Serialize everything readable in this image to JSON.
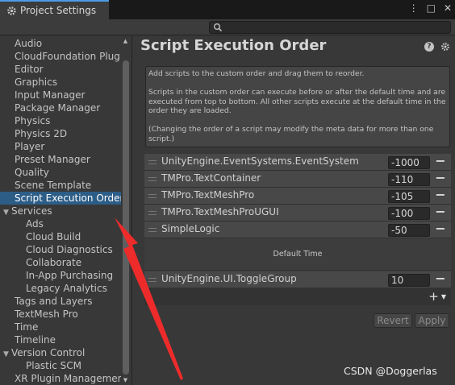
{
  "window": {
    "tab_title": "Project Settings",
    "icons": [
      "more-vert-icon",
      "maximize-icon",
      "close-icon"
    ],
    "icon_glyphs": [
      "⋮",
      "□",
      "✕"
    ]
  },
  "search": {
    "placeholder": "",
    "value": ""
  },
  "sidebar": {
    "items": [
      {
        "label": "Audio",
        "indent": 0
      },
      {
        "label": "CloudFoundation Plugin",
        "indent": 0
      },
      {
        "label": "Editor",
        "indent": 0
      },
      {
        "label": "Graphics",
        "indent": 0
      },
      {
        "label": "Input Manager",
        "indent": 0
      },
      {
        "label": "Package Manager",
        "indent": 0
      },
      {
        "label": "Physics",
        "indent": 0
      },
      {
        "label": "Physics 2D",
        "indent": 0
      },
      {
        "label": "Player",
        "indent": 0
      },
      {
        "label": "Preset Manager",
        "indent": 0
      },
      {
        "label": "Quality",
        "indent": 0
      },
      {
        "label": "Scene Template",
        "indent": 0
      },
      {
        "label": "Script Execution Order",
        "indent": 0,
        "selected": true
      },
      {
        "label": "Services",
        "indent": 0,
        "expandable": true
      },
      {
        "label": "Ads",
        "indent": 1
      },
      {
        "label": "Cloud Build",
        "indent": 1
      },
      {
        "label": "Cloud Diagnostics",
        "indent": 1
      },
      {
        "label": "Collaborate",
        "indent": 1
      },
      {
        "label": "In-App Purchasing",
        "indent": 1
      },
      {
        "label": "Legacy Analytics",
        "indent": 1
      },
      {
        "label": "Tags and Layers",
        "indent": 0
      },
      {
        "label": "TextMesh Pro",
        "indent": 0
      },
      {
        "label": "Time",
        "indent": 0
      },
      {
        "label": "Timeline",
        "indent": 0
      },
      {
        "label": "Version Control",
        "indent": 0,
        "expandable": true
      },
      {
        "label": "Plastic SCM",
        "indent": 1
      },
      {
        "label": "XR Plugin Management",
        "indent": 0
      }
    ]
  },
  "main": {
    "title": "Script Execution Order",
    "description": [
      "Add scripts to the custom order and drag them to reorder.",
      "Scripts in the custom order can execute before or after the default time and are executed from top to bottom. All other scripts execute at the default time in the order they are loaded.",
      "(Changing the order of a script may modify the meta data for more than one script.)"
    ],
    "rows_before": [
      {
        "name": "UnityEngine.EventSystems.EventSystem",
        "order": "-1000"
      },
      {
        "name": "TMPro.TextContainer",
        "order": "-110"
      },
      {
        "name": "TMPro.TextMeshPro",
        "order": "-105"
      },
      {
        "name": "TMPro.TextMeshProUGUI",
        "order": "-100"
      },
      {
        "name": "SimpleLogic",
        "order": "-50"
      }
    ],
    "default_time_label": "Default Time",
    "rows_after": [
      {
        "name": "UnityEngine.UI.ToggleGroup",
        "order": "10"
      }
    ],
    "remove_glyph": "−",
    "add_glyph": "+",
    "add_caret": "▼",
    "revert_label": "Revert",
    "apply_label": "Apply"
  },
  "watermark": "CSDN @Doggerlas",
  "colors": {
    "selection": "#2c5d87",
    "annotation_arrow": "#ee2b2b",
    "tab_accent": "#4d9be6"
  }
}
